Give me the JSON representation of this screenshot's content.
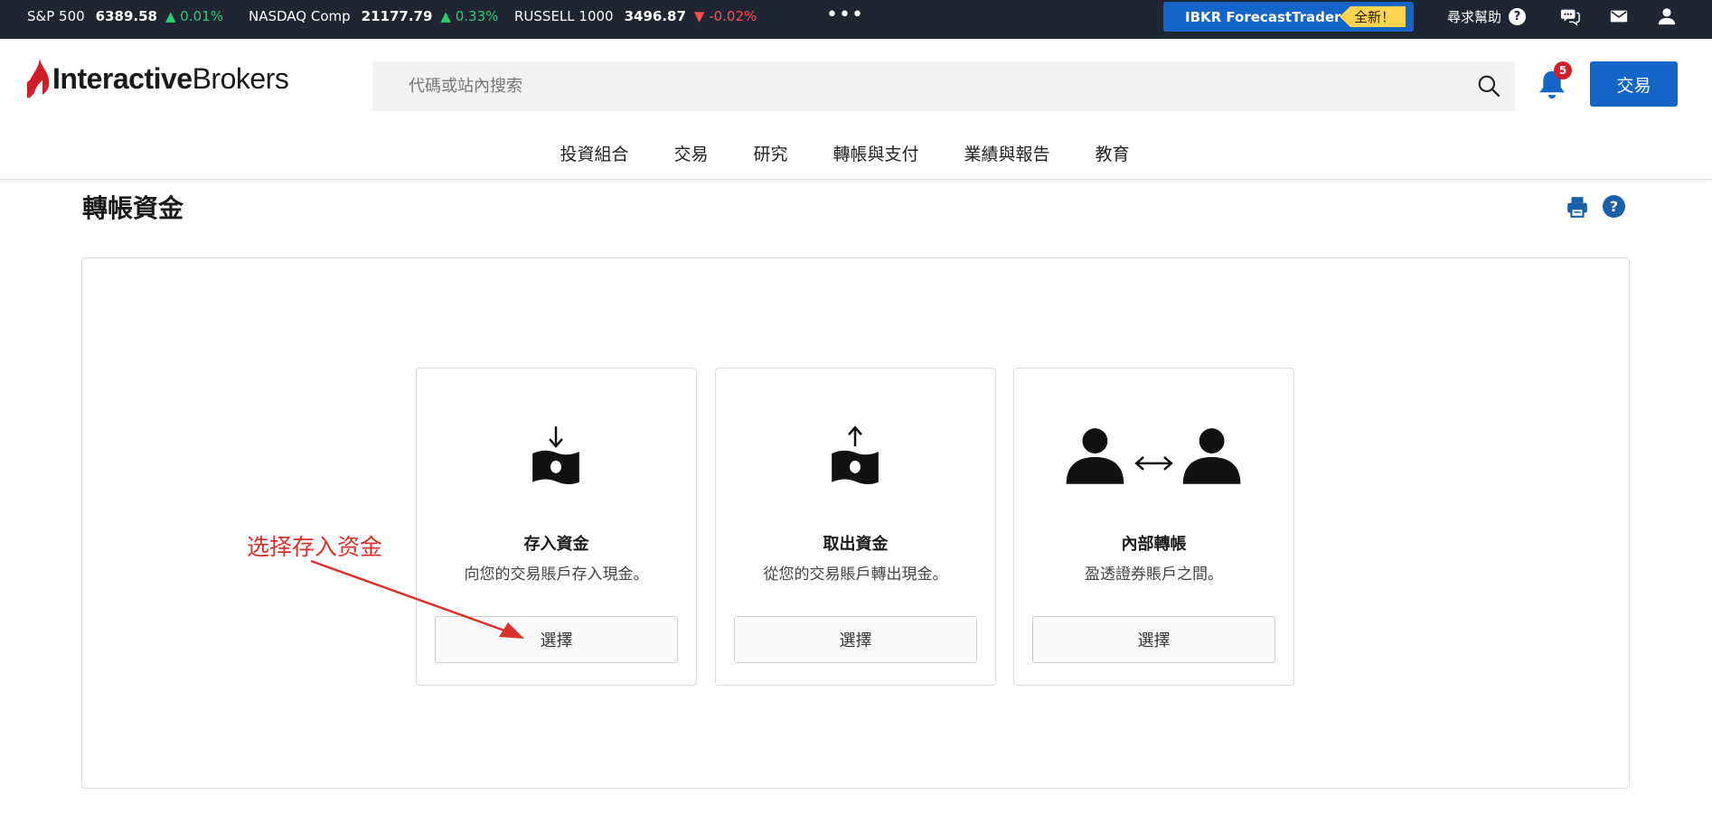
{
  "ticker": {
    "items": [
      {
        "name": "S&P 500",
        "value": "6389.58",
        "change": "▲ 0.01%",
        "direction": "up"
      },
      {
        "name": "NASDAQ Comp",
        "value": "21177.79",
        "change": "▲ 0.33%",
        "direction": "up"
      },
      {
        "name": "RUSSELL 1000",
        "value": "3496.87",
        "change": "▼ -0.02%",
        "direction": "down"
      }
    ],
    "more_label": "•••",
    "promo_label": "IBKR ForecastTrader",
    "promo_badge": "全新！",
    "help_label": "尋求幫助",
    "help_q": "?"
  },
  "header": {
    "logo_bold": "Interactive",
    "logo_regular": "Brokers",
    "search_placeholder": "代碼或站內搜索",
    "notification_count": "5",
    "trade_button": "交易"
  },
  "nav": {
    "items": [
      "投資組合",
      "交易",
      "研究",
      "轉帳與支付",
      "業績與報告",
      "教育"
    ]
  },
  "page": {
    "title": "轉帳資金",
    "help_q": "?"
  },
  "cards": [
    {
      "title": "存入資金",
      "description": "向您的交易賬戶存入現金。",
      "button": "選擇"
    },
    {
      "title": "取出資金",
      "description": "從您的交易賬戶轉出現金。",
      "button": "選擇"
    },
    {
      "title": "內部轉帳",
      "description": "盈透證券賬戶之間。",
      "button": "選擇"
    }
  ],
  "annotation": {
    "text": "选择存入资金",
    "color": "#d9312b"
  },
  "colors": {
    "ticker_bg": "#1f2533",
    "brand_blue": "#1565c8",
    "logo_red": "#d11f2a",
    "up": "#2ecc71",
    "down": "#ff4d4d"
  }
}
